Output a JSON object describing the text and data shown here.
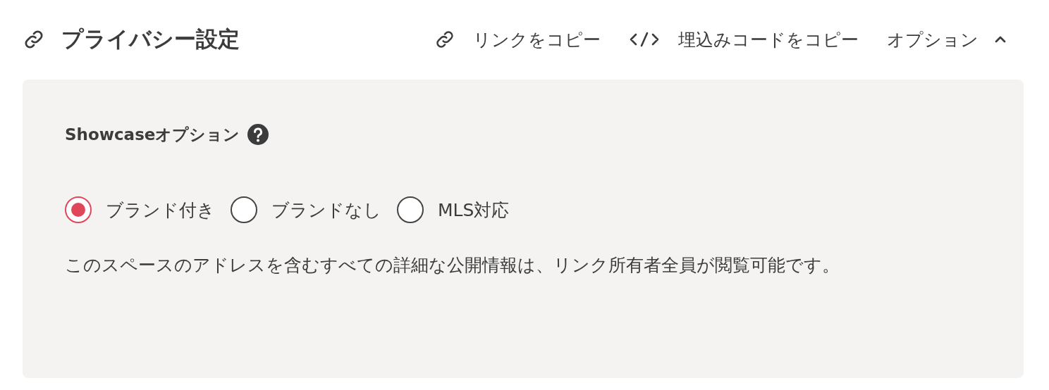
{
  "header": {
    "title": "プライバシー設定",
    "actions": [
      {
        "kind": "link",
        "label": "リンクをコピー"
      },
      {
        "kind": "code",
        "label": "埋込みコードをコピー"
      },
      {
        "kind": "toggle",
        "label": "オプション",
        "expanded": true
      }
    ]
  },
  "panel": {
    "heading": "Showcaseオプション",
    "radios": [
      {
        "label": "ブランド付き",
        "selected": true
      },
      {
        "label": "ブランドなし",
        "selected": false
      },
      {
        "label": "MLS対応",
        "selected": false
      }
    ],
    "description": "このスペースのアドレスを含むすべての詳細な公開情報は、リンク所有者全員が閲覧可能です。"
  }
}
